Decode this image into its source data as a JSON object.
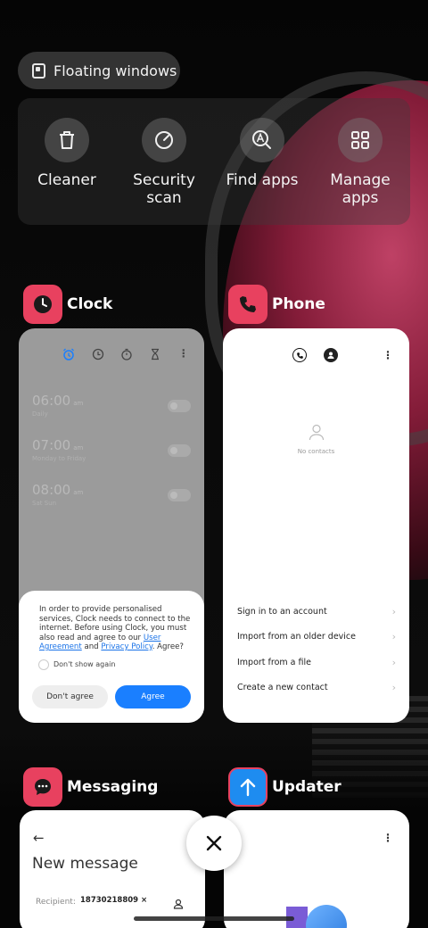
{
  "floating_windows": {
    "label": "Floating windows"
  },
  "quick_actions": [
    {
      "label": "Cleaner",
      "icon": "trash-icon"
    },
    {
      "label": "Security scan",
      "icon": "gauge-icon"
    },
    {
      "label": "Find apps",
      "icon": "search-app-icon"
    },
    {
      "label": "Manage apps",
      "icon": "grid-icon"
    }
  ],
  "apps": {
    "clock": {
      "name": "Clock",
      "alarms": [
        {
          "time": "06:00",
          "ampm": "am",
          "repeat": "Daily"
        },
        {
          "time": "07:00",
          "ampm": "am",
          "repeat": "Monday to Friday"
        },
        {
          "time": "08:00",
          "ampm": "am",
          "repeat": "Sat Sun"
        }
      ],
      "dialog": {
        "text_1": "In order to provide personalised services, Clock needs to connect to the internet. Before using Clock, you must also read and agree to our ",
        "link_1": "User Agreement",
        "text_2": " and ",
        "link_2": "Privacy Policy",
        "text_3": ". Agree?",
        "checkbox": "Don't show again",
        "disagree": "Don't agree",
        "agree": "Agree"
      }
    },
    "phone": {
      "name": "Phone",
      "empty": "No contacts",
      "options": [
        "Sign in to an account",
        "Import from an older device",
        "Import from a file",
        "Create a new contact"
      ]
    },
    "messaging": {
      "name": "Messaging",
      "title": "New message",
      "recipient_label": "Recipient:",
      "recipient": "18730218809 ×"
    },
    "updater": {
      "name": "Updater"
    }
  },
  "colors": {
    "clock_icon": "#e8415f",
    "phone_icon": "#e8415f",
    "messaging_icon": "#e8415f",
    "updater_icon": "#1e8cf0",
    "agree_button": "#1a7fff"
  }
}
